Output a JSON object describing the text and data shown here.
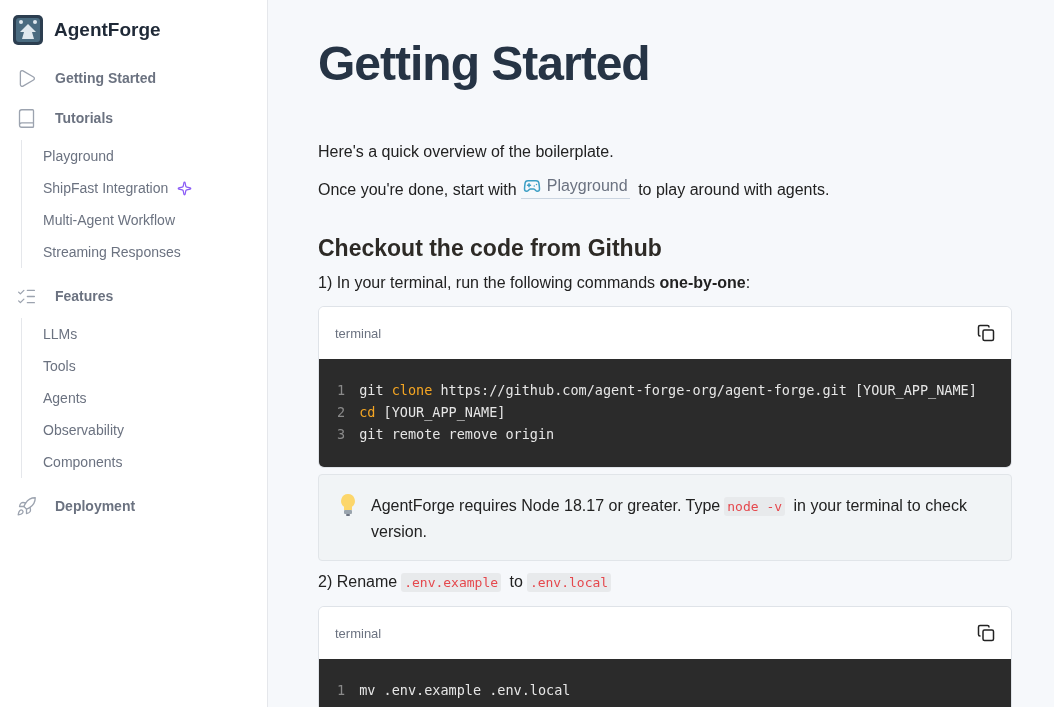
{
  "sidebar": {
    "brand": "AgentForge",
    "sections": [
      {
        "label": "Getting Started"
      },
      {
        "label": "Tutorials",
        "children": [
          {
            "label": "Playground",
            "new": false
          },
          {
            "label": "ShipFast Integration",
            "new": true
          },
          {
            "label": "Multi-Agent Workflow",
            "new": false
          },
          {
            "label": "Streaming Responses",
            "new": false
          }
        ]
      },
      {
        "label": "Features",
        "children": [
          {
            "label": "LLMs",
            "new": false
          },
          {
            "label": "Tools",
            "new": false
          },
          {
            "label": "Agents",
            "new": false
          },
          {
            "label": "Observability",
            "new": false
          },
          {
            "label": "Components",
            "new": false
          }
        ]
      },
      {
        "label": "Deployment"
      }
    ]
  },
  "main": {
    "title": "Getting Started",
    "blocks": [
      {
        "kind": "paragraph",
        "segments": [
          {
            "kind": "text",
            "text": "Here's a quick overview of the boilerplate."
          }
        ]
      },
      {
        "kind": "paragraph",
        "segments": [
          {
            "kind": "text",
            "text": "Once you're done, start with"
          },
          {
            "kind": "link",
            "text": "Playground"
          },
          {
            "kind": "text",
            "text": "to play around with agents."
          }
        ]
      },
      {
        "kind": "heading",
        "text": "Checkout the code from Github"
      },
      {
        "kind": "paragraph",
        "segments": [
          {
            "kind": "text",
            "text": "1) In your terminal, run the following commands **one-by-one**:"
          }
        ]
      },
      {
        "kind": "code",
        "label": "terminal",
        "lines": [
          {
            "number": "1",
            "tokens": [
              {
                "kind": "plain",
                "text": "git "
              },
              {
                "kind": "keyword",
                "text": "clone"
              },
              {
                "kind": "plain",
                "text": " https://github.com/agent-forge-org/agent-forge.git [YOUR_APP_NAME]"
              }
            ]
          },
          {
            "number": "2",
            "tokens": [
              {
                "kind": "keyword",
                "text": "cd"
              },
              {
                "kind": "plain",
                "text": " [YOUR_APP_NAME]"
              }
            ]
          },
          {
            "number": "3",
            "tokens": [
              {
                "kind": "plain",
                "text": "git remote remove origin"
              }
            ]
          }
        ]
      },
      {
        "kind": "callout",
        "segments": [
          {
            "kind": "text",
            "text": "AgentForge requires Node 18.17 or greater. Type"
          },
          {
            "kind": "code",
            "text": "node -v"
          },
          {
            "kind": "text",
            "text": "in your terminal to check version."
          }
        ]
      },
      {
        "kind": "paragraph",
        "segments": [
          {
            "kind": "text",
            "text": "2) Rename"
          },
          {
            "kind": "code",
            "text": ".env.example"
          },
          {
            "kind": "text",
            "text": "to"
          },
          {
            "kind": "code",
            "text": ".env.local"
          }
        ]
      },
      {
        "kind": "code",
        "label": "terminal",
        "lines": [
          {
            "number": "1",
            "tokens": [
              {
                "kind": "plain",
                "text": "mv .env.example .env.local"
              }
            ]
          }
        ]
      }
    ]
  }
}
